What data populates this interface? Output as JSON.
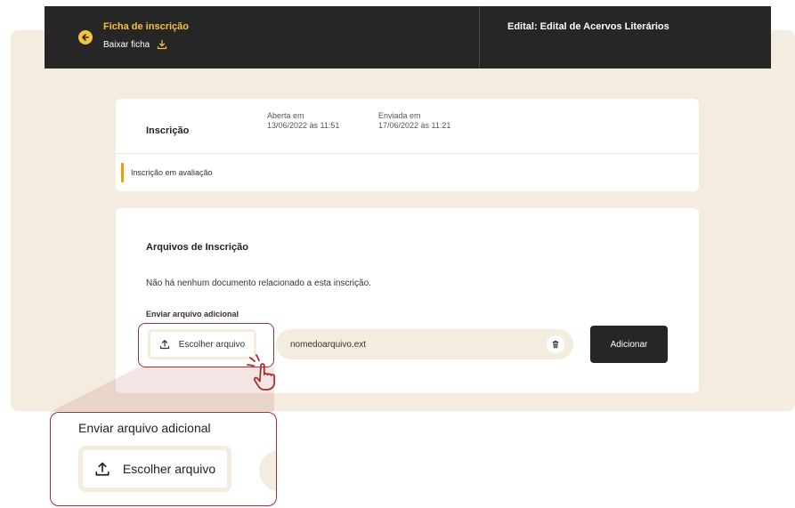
{
  "header": {
    "title": "Ficha de inscrição",
    "download_label": "Baixar ficha",
    "edital_title": "Edital: Edital de Acervos Literários"
  },
  "status_card": {
    "label": "Inscrição",
    "opened_label": "Aberta em",
    "opened_value": "13/06/2022 às 11:51",
    "sent_label": "Enviada em",
    "sent_value": "17/06/2022 às 11:21",
    "status": "Inscrição em avaliação"
  },
  "files_card": {
    "title": "Arquivos de Inscrição",
    "empty_message": "Não há nenhum documento relacionado a esta inscrição.",
    "send_label": "Enviar arquivo adicional",
    "choose_button": "Escolher arquivo",
    "file_name": "nomedoarquivo.ext",
    "add_button": "Adicionar"
  },
  "zoom": {
    "label": "Enviar arquivo adicional",
    "choose_button": "Escolher arquivo"
  },
  "icons": {
    "back": "arrow-left-icon",
    "download": "download-icon",
    "upload": "upload-icon",
    "trash": "trash-icon",
    "pointer": "hand-pointer-icon"
  },
  "colors": {
    "accent": "#f5c242",
    "status_bar": "#e6a100",
    "dark": "#262626",
    "panel_bg": "#f3ecdf",
    "highlight": "#a82d2d"
  }
}
